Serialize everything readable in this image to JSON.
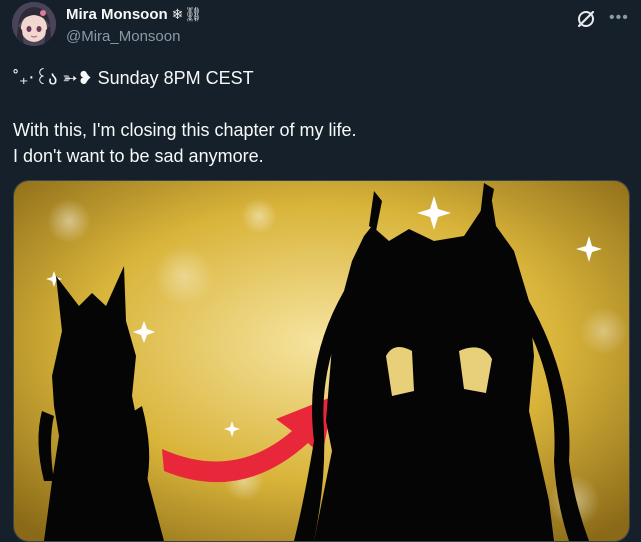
{
  "author": {
    "display_name": "Mira Monsoon",
    "badges": "❄⛓",
    "handle": "@Mira_Monsoon"
  },
  "post": {
    "line1": "˚₊‧꒰ა ➳❥ Sunday 8PM CEST",
    "line2": "With this, I'm closing this chapter of my life.",
    "line3": "I don't want to be sad anymore."
  },
  "icons": {
    "grok": "grok-icon",
    "more": "more-icon"
  },
  "colors": {
    "background": "#15202b",
    "secondary_text": "#8b98a5",
    "arrow": "#e8283a",
    "gold": "#d9b43a"
  }
}
